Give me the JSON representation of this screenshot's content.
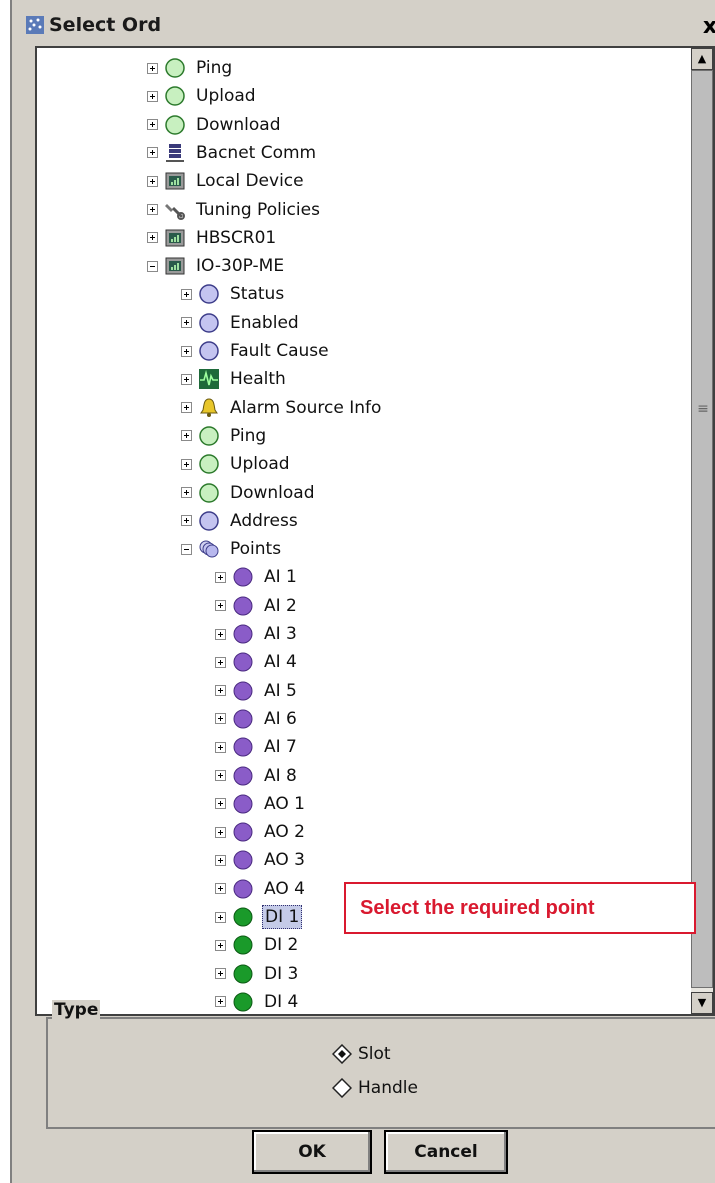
{
  "window": {
    "title": "Select Ord",
    "close_label": "x"
  },
  "tree": [
    {
      "label": "Ping",
      "icon": "green-circle-icon",
      "depth": 0,
      "expander": "plus"
    },
    {
      "label": "Upload",
      "icon": "green-circle-icon",
      "depth": 0,
      "expander": "plus"
    },
    {
      "label": "Download",
      "icon": "green-circle-icon",
      "depth": 0,
      "expander": "plus"
    },
    {
      "label": "Bacnet Comm",
      "icon": "server-icon",
      "depth": 0,
      "expander": "plus"
    },
    {
      "label": "Local Device",
      "icon": "device-icon",
      "depth": 0,
      "expander": "plus"
    },
    {
      "label": "Tuning Policies",
      "icon": "wrench-icon",
      "depth": 0,
      "expander": "plus"
    },
    {
      "label": "HBSCR01",
      "icon": "device-icon",
      "depth": 0,
      "expander": "plus"
    },
    {
      "label": "IO-30P-ME",
      "icon": "device-icon",
      "depth": 0,
      "expander": "minus"
    },
    {
      "label": "Status",
      "icon": "lavender-circle-icon",
      "depth": 1,
      "expander": "plus"
    },
    {
      "label": "Enabled",
      "icon": "lavender-circle-icon",
      "depth": 1,
      "expander": "plus"
    },
    {
      "label": "Fault Cause",
      "icon": "lavender-circle-icon",
      "depth": 1,
      "expander": "plus"
    },
    {
      "label": "Health",
      "icon": "health-icon",
      "depth": 1,
      "expander": "plus"
    },
    {
      "label": "Alarm Source Info",
      "icon": "bell-icon",
      "depth": 1,
      "expander": "plus"
    },
    {
      "label": "Ping",
      "icon": "green-circle-icon",
      "depth": 1,
      "expander": "plus"
    },
    {
      "label": "Upload",
      "icon": "green-circle-icon",
      "depth": 1,
      "expander": "plus"
    },
    {
      "label": "Download",
      "icon": "green-circle-icon",
      "depth": 1,
      "expander": "plus"
    },
    {
      "label": "Address",
      "icon": "lavender-circle-icon",
      "depth": 1,
      "expander": "plus"
    },
    {
      "label": "Points",
      "icon": "points-icon",
      "depth": 1,
      "expander": "minus"
    },
    {
      "label": "AI 1",
      "icon": "purple-dot-icon",
      "depth": 2,
      "expander": "plus"
    },
    {
      "label": "AI 2",
      "icon": "purple-dot-icon",
      "depth": 2,
      "expander": "plus"
    },
    {
      "label": "AI 3",
      "icon": "purple-dot-icon",
      "depth": 2,
      "expander": "plus"
    },
    {
      "label": "AI 4",
      "icon": "purple-dot-icon",
      "depth": 2,
      "expander": "plus"
    },
    {
      "label": "AI 5",
      "icon": "purple-dot-icon",
      "depth": 2,
      "expander": "plus"
    },
    {
      "label": "AI 6",
      "icon": "purple-dot-icon",
      "depth": 2,
      "expander": "plus"
    },
    {
      "label": "AI 7",
      "icon": "purple-dot-icon",
      "depth": 2,
      "expander": "plus"
    },
    {
      "label": "AI 8",
      "icon": "purple-dot-icon",
      "depth": 2,
      "expander": "plus"
    },
    {
      "label": "AO 1",
      "icon": "purple-dot-icon",
      "depth": 2,
      "expander": "plus"
    },
    {
      "label": "AO 2",
      "icon": "purple-dot-icon",
      "depth": 2,
      "expander": "plus"
    },
    {
      "label": "AO 3",
      "icon": "purple-dot-icon",
      "depth": 2,
      "expander": "plus"
    },
    {
      "label": "AO 4",
      "icon": "purple-dot-icon",
      "depth": 2,
      "expander": "plus"
    },
    {
      "label": "DI 1",
      "icon": "green-dot-icon",
      "depth": 2,
      "expander": "plus",
      "selected": true
    },
    {
      "label": "DI 2",
      "icon": "green-dot-icon",
      "depth": 2,
      "expander": "plus"
    },
    {
      "label": "DI 3",
      "icon": "green-dot-icon",
      "depth": 2,
      "expander": "plus"
    },
    {
      "label": "DI 4",
      "icon": "green-dot-icon",
      "depth": 2,
      "expander": "plus"
    }
  ],
  "callout": "Select the required point",
  "type_group": {
    "legend": "Type",
    "options": [
      {
        "label": "Slot",
        "selected": true
      },
      {
        "label": "Handle",
        "selected": false
      }
    ]
  },
  "buttons": {
    "ok": "OK",
    "cancel": "Cancel"
  },
  "colors": {
    "green_circle": "#c8f0c0",
    "lavender_circle": "#c4c4f0",
    "purple_dot": "#8a5cc8",
    "green_dot": "#1a9a2a",
    "callout_red": "#d9192f",
    "selection": "#c5cbe8"
  }
}
